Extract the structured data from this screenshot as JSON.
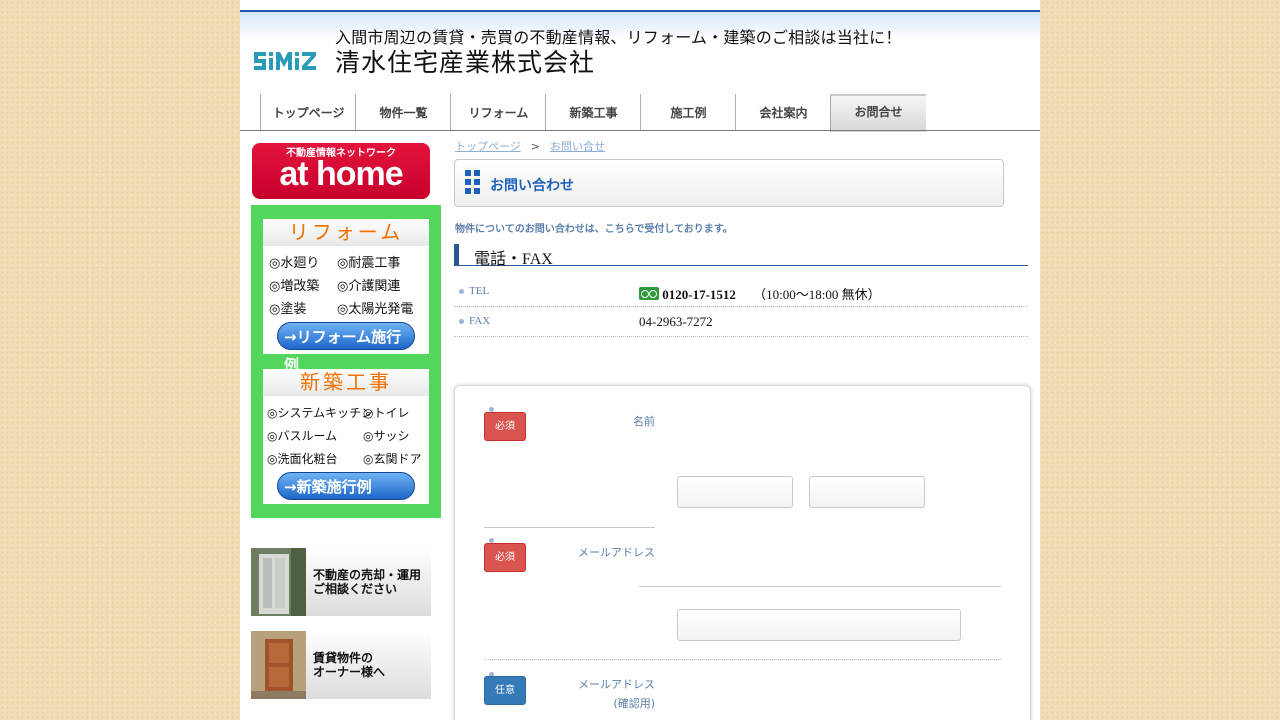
{
  "header": {
    "tagline": "入間市周辺の賃貸・売買の不動産情報、リフォーム・建築のご相談は当社に！",
    "logo_text": "SiMiZ",
    "company_name": "清水住宅産業株式会社"
  },
  "nav": {
    "items": [
      {
        "label": "トップページ"
      },
      {
        "label": "物件一覧"
      },
      {
        "label": "リフォーム"
      },
      {
        "label": "新築工事"
      },
      {
        "label": "施工例"
      },
      {
        "label": "会社案内"
      },
      {
        "label": "お問合せ"
      }
    ],
    "active": "お問合せ"
  },
  "sidebar": {
    "athome": {
      "network": "不動産情報ネットワーク",
      "brand": "at home"
    },
    "reform": {
      "title": "リフォーム",
      "items": [
        "◎水廻り",
        "◎耐震工事",
        "◎増改築",
        "◎介護関連",
        "◎塗装",
        "◎太陽光発電"
      ],
      "button": "→リフォーム施行例"
    },
    "newbuild": {
      "title": "新築工事",
      "items": [
        "◎システムキッチン",
        "◎トイレ",
        "◎バスルーム",
        "◎サッシ",
        "◎洗面化粧台",
        "◎玄関ドア"
      ],
      "button": "→新築施行例"
    },
    "banners": [
      {
        "line1": "不動産の売却・運用",
        "line2": "ご相談ください"
      },
      {
        "line1": "賃貸物件の",
        "line2": "オーナー様へ"
      }
    ]
  },
  "main": {
    "breadcrumb": {
      "home": "トップページ",
      "separator": ">",
      "current": "お問い合せ"
    },
    "title": "お問い合わせ",
    "intro": "物件についてのお問い合わせは、こちらで受付しております。",
    "phone_section": {
      "heading": "電話・FAX",
      "tel_label": "TEL",
      "tel_number": "0120-17-1512",
      "tel_hours": "（10:00～18:00 無休）",
      "fax_label": "FAX",
      "fax_number": "04-2963-7272"
    },
    "form": {
      "required_badge": "必須",
      "optional_badge": "任意",
      "name_label": "名前",
      "email_label": "メールアドレス",
      "email_confirm_label": "メールアドレス",
      "email_confirm_sub": "(確認用)"
    }
  },
  "colors": {
    "accent": "#1e61b8",
    "sidebar_green": "#52d65b",
    "required": "#d9534f",
    "optional": "#337ab7"
  }
}
